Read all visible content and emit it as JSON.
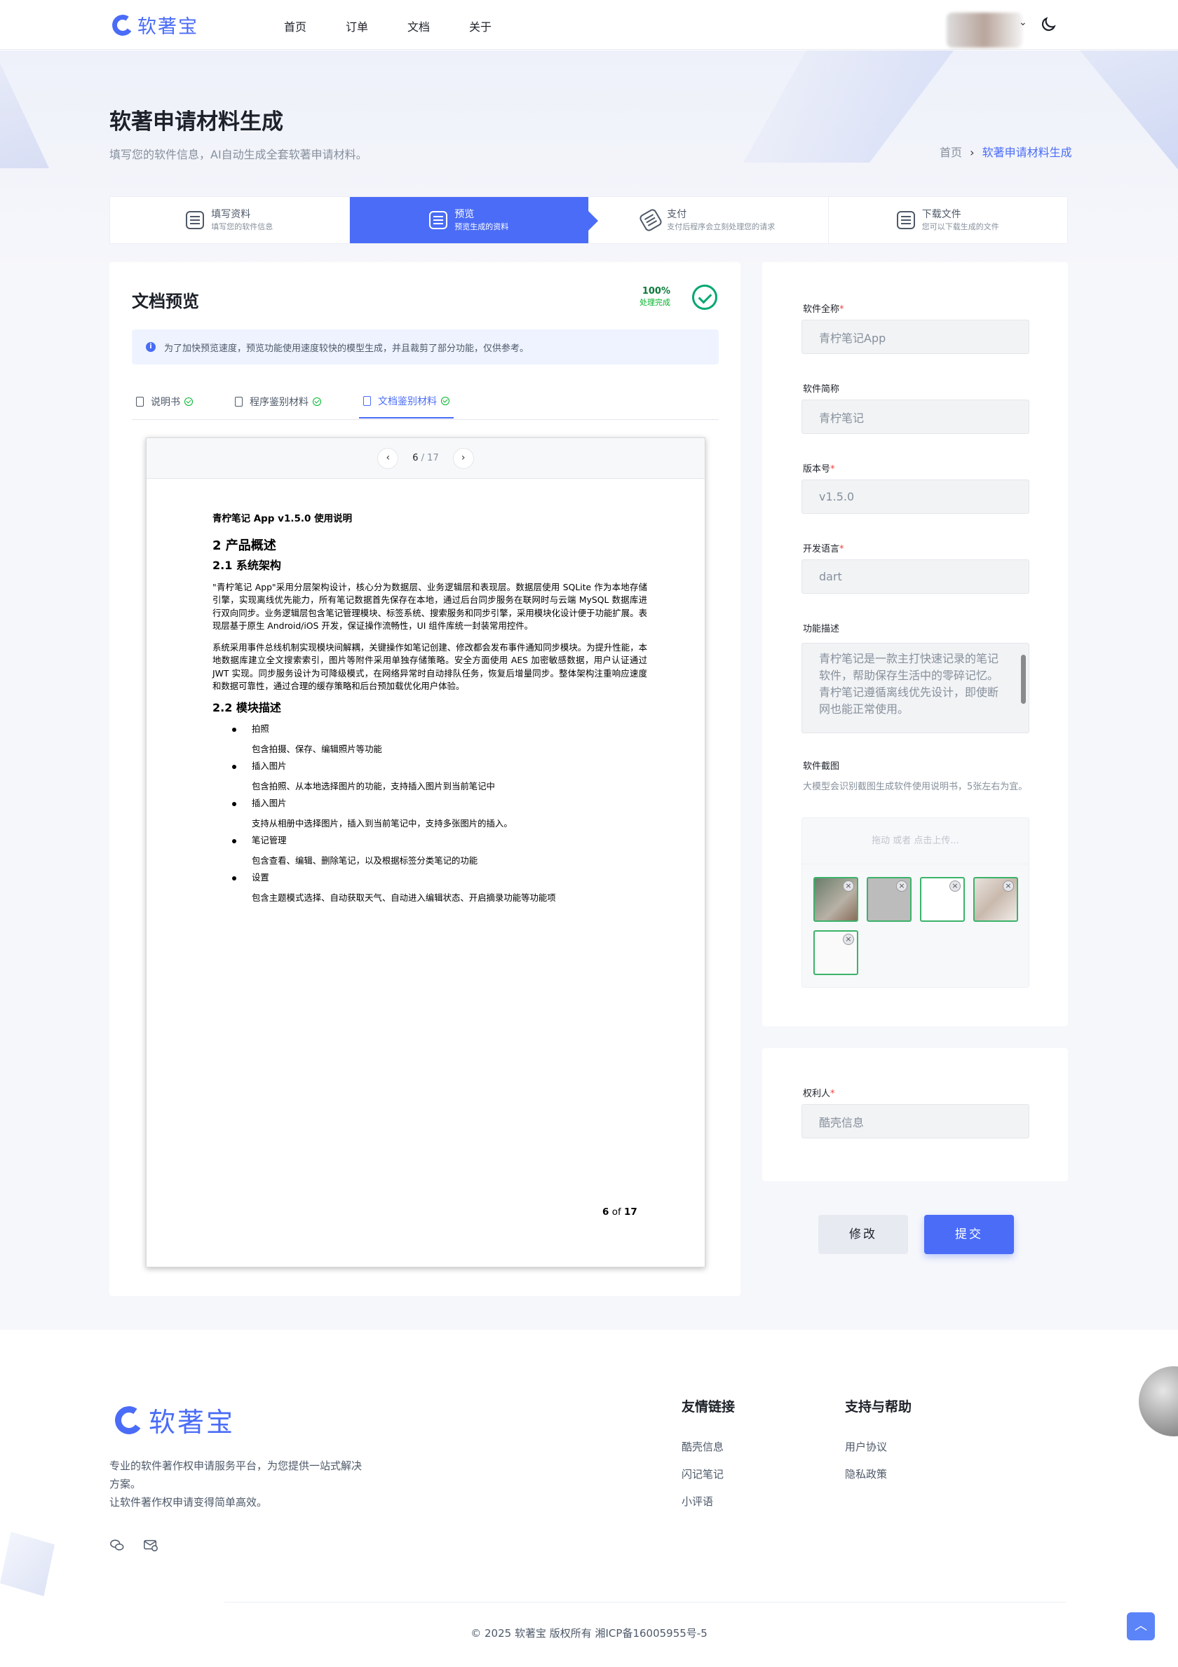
{
  "header": {
    "logo_text": "软著宝",
    "nav": [
      "首页",
      "订单",
      "文档",
      "关于"
    ]
  },
  "page": {
    "title": "软著申请材料生成",
    "subtitle": "填写您的软件信息，AI自动生成全套软著申请材料。",
    "breadcrumb": {
      "home": "首页",
      "sep": "›",
      "current": "软著申请材料生成"
    }
  },
  "steps": [
    {
      "title": "填写资料",
      "desc": "填写您的软件信息",
      "active": false
    },
    {
      "title": "预览",
      "desc": "预览生成的资料",
      "active": true
    },
    {
      "title": "支付",
      "desc": "支付后程序会立刻处理您的请求",
      "active": false
    },
    {
      "title": "下载文件",
      "desc": "您可以下载生成的文件",
      "active": false
    }
  ],
  "preview": {
    "title": "文档预览",
    "progress": "100%",
    "progress_label": "处理完成",
    "notice": "为了加快预览速度，预览功能使用速度较快的模型生成，并且裁剪了部分功能，仅供参考。",
    "tabs": [
      "说明书",
      "程序鉴别材料",
      "文档鉴别材料"
    ],
    "active_tab": 2,
    "pager": {
      "current": "6",
      "total": "/ 17"
    },
    "doc": {
      "header": "青柠笔记 App v1.5.0    使用说明",
      "h2": "2   产品概述",
      "h3a": "2.1  系统架构",
      "p1": "\"青柠笔记 App\"采用分层架构设计，核心分为数据层、业务逻辑层和表现层。数据层使用 SQLite 作为本地存储引擎，实现离线优先能力，所有笔记数据首先保存在本地，通过后台同步服务在联网时与云端 MySQL 数据库进行双向同步。业务逻辑层包含笔记管理模块、标签系统、搜索服务和同步引擎，采用模块化设计便于功能扩展。表现层基于原生 Android/iOS 开发，保证操作流畅性，UI 组件库统一封装常用控件。",
      "p2": "系统采用事件总线机制实现模块间解耦，关键操作如笔记创建、修改都会发布事件通知同步模块。为提升性能，本地数据库建立全文搜索索引，图片等附件采用单独存储策略。安全方面使用 AES 加密敏感数据，用户认证通过 JWT 实现。同步服务设计为可降级模式，在网络异常时自动排队任务，恢复后增量同步。整体架构注重响应速度和数据可靠性，通过合理的缓存策略和后台预加载优化用户体验。",
      "h3b": "2.2  模块描述",
      "modules": [
        {
          "name": "拍照",
          "desc": "包含拍摄、保存、编辑照片等功能"
        },
        {
          "name": "插入图片",
          "desc": "包含拍照、从本地选择图片的功能，支持插入图片到当前笔记中"
        },
        {
          "name": "插入图片",
          "desc": "支持从相册中选择图片，插入到当前笔记中，支持多张图片的插入。"
        },
        {
          "name": "笔记管理",
          "desc": "包含查看、编辑、删除笔记，以及根据标签分类笔记的功能"
        },
        {
          "name": "设置",
          "desc": "包含主题模式选择、自动获取天气、自动进入编辑状态、开启摘录功能等功能项"
        }
      ],
      "footer_page": "6",
      "footer_of": "of",
      "footer_total": "17"
    }
  },
  "form": {
    "full_name_label": "软件全称",
    "full_name": "青柠笔记App",
    "short_name_label": "软件简称",
    "short_name": "青柠笔记",
    "version_label": "版本号",
    "version": "v1.5.0",
    "lang_label": "开发语言",
    "lang": "dart",
    "func_label": "功能描述",
    "func": "青柠笔记是一款主打快速记录的笔记软件，帮助保存生活中的零碎记忆。青柠笔记遵循离线优先设计，即使断网也能正常使用。",
    "shots_label": "软件截图",
    "shots_hint": "大模型会识别截图生成软件使用说明书，5张左右为宜。",
    "upload_text": "拖动 或者 点击上传...",
    "owner_label": "权利人",
    "owner": "酷壳信息",
    "required_mark": "*",
    "remove_icon": "×"
  },
  "buttons": {
    "edit": "修改",
    "submit": "提交"
  },
  "footer": {
    "logo_text": "软著宝",
    "desc1": "专业的软件著作权申请服务平台，为您提供一站式解决方案。",
    "desc2": "让软件著作权申请变得简单高效。",
    "friend_title": "友情链接",
    "friend_links": [
      "酷壳信息",
      "闪记笔记",
      "小评语"
    ],
    "help_title": "支持与帮助",
    "help_links": [
      "用户协议",
      "隐私政策"
    ],
    "copyright": "© 2025 软著宝 版权所有 湘ICP备16005955号-5"
  }
}
